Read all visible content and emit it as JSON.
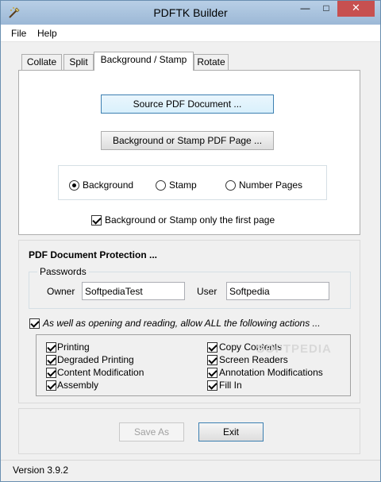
{
  "window": {
    "title": "PDFTK Builder",
    "close_glyph": "✕",
    "min_glyph": "—",
    "max_glyph": "□"
  },
  "menu": {
    "items": [
      "File",
      "Help"
    ]
  },
  "tabs": [
    "Collate",
    "Split",
    "Background / Stamp",
    "Rotate"
  ],
  "active_tab": "Background / Stamp",
  "bg_stamp": {
    "source_button": "Source PDF Document ...",
    "stamp_button": "Background or Stamp PDF Page ...",
    "mode_options": [
      "Background",
      "Stamp",
      "Number Pages"
    ],
    "mode_selected": "Background",
    "first_page_label": "Background or Stamp only the first page",
    "first_page_checked": true
  },
  "protection": {
    "heading": "PDF Document Protection ...",
    "passwords_label": "Passwords",
    "owner_label": "Owner",
    "owner_value": "SoftpediaTest",
    "user_label": "User",
    "user_value": "Softpedia",
    "allow_label": "As well as opening and reading, allow ALL the following actions ...",
    "allow_checked": true,
    "permissions": [
      {
        "label": "Printing",
        "checked": true
      },
      {
        "label": "Degraded Printing",
        "checked": true
      },
      {
        "label": "Content Modification",
        "checked": true
      },
      {
        "label": "Assembly",
        "checked": true
      },
      {
        "label": "Copy Contents",
        "checked": true
      },
      {
        "label": "Screen Readers",
        "checked": true
      },
      {
        "label": "Annotation Modifications",
        "checked": true
      },
      {
        "label": "Fill In",
        "checked": true
      }
    ]
  },
  "actions": {
    "save_as": "Save As",
    "exit": "Exit"
  },
  "status": {
    "version": "Version 3.9.2"
  },
  "watermark": "SOFTPEDIA",
  "colors": {
    "title_bar": "#9cb8d6",
    "close_button": "#c75050",
    "focus_border": "#3c7fb1"
  },
  "icons": {
    "app": "pen-icon"
  }
}
